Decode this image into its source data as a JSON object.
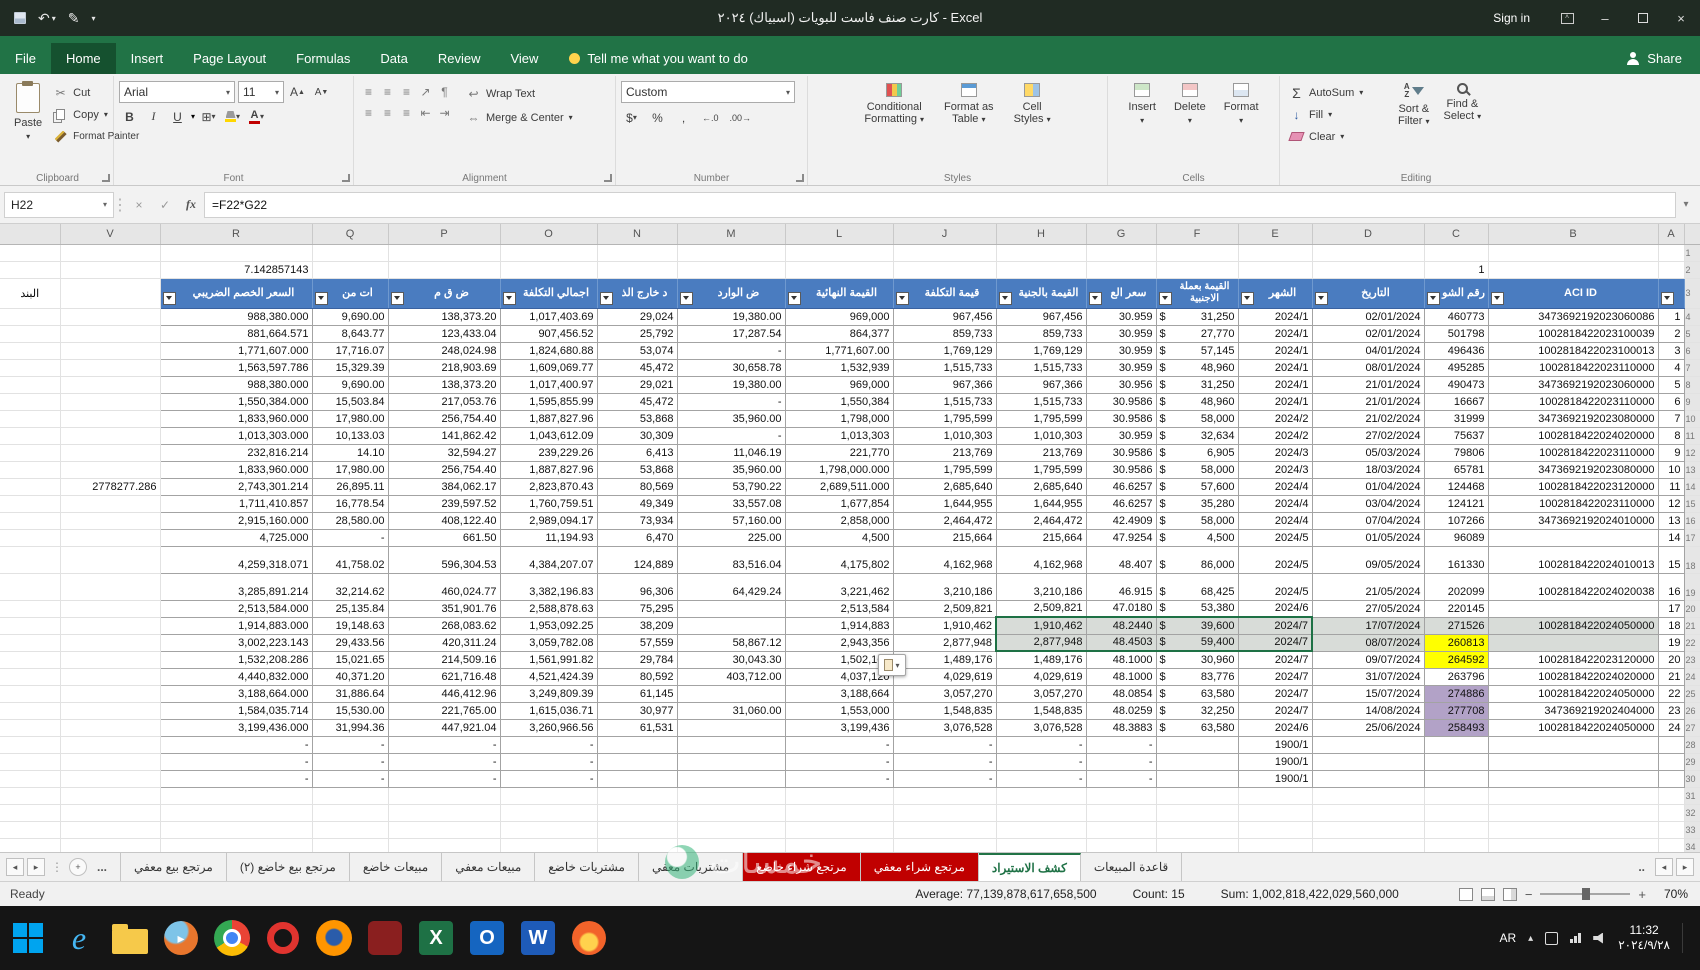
{
  "titlebar": {
    "title": "كارت صنف فاست للبويات (اسبياك) ٢٠٢٤  -  Excel",
    "sign_in": "Sign in"
  },
  "ribbon": {
    "tabs": [
      {
        "label": "File"
      },
      {
        "label": "Home",
        "active": true
      },
      {
        "label": "Insert"
      },
      {
        "label": "Page Layout"
      },
      {
        "label": "Formulas"
      },
      {
        "label": "Data"
      },
      {
        "label": "Review"
      },
      {
        "label": "View"
      }
    ],
    "tell_me": "Tell me what you want to do",
    "share": "Share",
    "clipboard": {
      "label": "Clipboard",
      "paste": "Paste",
      "cut": "Cut",
      "copy": "Copy",
      "format_painter": "Format Painter"
    },
    "font": {
      "label": "Font",
      "family": "Arial",
      "size": "11"
    },
    "alignment": {
      "label": "Alignment",
      "wrap": "Wrap Text",
      "merge": "Merge & Center"
    },
    "number": {
      "label": "Number",
      "format": "Custom"
    },
    "styles": {
      "label": "Styles",
      "cond1": "Conditional",
      "cond2": "Formatting",
      "fat1": "Format as",
      "fat2": "Table",
      "cs1": "Cell",
      "cs2": "Styles"
    },
    "cells": {
      "label": "Cells",
      "insert": "Insert",
      "delete": "Delete",
      "format": "Format"
    },
    "editing": {
      "label": "Editing",
      "autosum": "AutoSum",
      "fill": "Fill",
      "clear": "Clear",
      "sf1": "Sort &",
      "sf2": "Filter",
      "fs1": "Find &",
      "fs2": "Select"
    }
  },
  "formula_bar": {
    "name_box": "H22",
    "fx": "fx",
    "formula": "=F22*G22"
  },
  "sheet": {
    "col_letters": [
      "",
      "V",
      "R",
      "Q",
      "P",
      "O",
      "N",
      "M",
      "L",
      "J",
      "H",
      "G",
      "F",
      "E",
      "D",
      "C",
      "B",
      "A",
      ""
    ],
    "bnd_header": "البند",
    "headers": {
      "r": "السعر الخصم الضريبي",
      "q": "ات من",
      "p": "ض ق م",
      "o": "اجمالي التكلفة",
      "n": "د خارج الذ",
      "m": "ض الوارد",
      "l": "القيمة النهائية",
      "j": "قيمة التكلفة",
      "h": "القيمة بالجنية",
      "g": "سعر الع",
      "f": "القيمة بعملة الاجنبية",
      "e": "الشهر",
      "d": "التاريخ",
      "c": "رقم الشو",
      "b": "ACI ID",
      "a": ""
    },
    "pre": {
      "r": "7.142857143",
      "c": "1"
    },
    "rows": [
      {
        "s": "1",
        "r": "988,380.000",
        "q": "9,690.00",
        "p": "138,373.20",
        "o": "1,017,403.69",
        "n": "29,024",
        "m": "19,380.00",
        "l": "969,000",
        "j": "967,456",
        "h": "967,456",
        "g": "30.959",
        "f": "31,250",
        "e": "2024/1",
        "d": "02/01/2024",
        "c": "460773",
        "b": "3473692192023060086"
      },
      {
        "s": "2",
        "r": "881,664.571",
        "q": "8,643.77",
        "p": "123,433.04",
        "o": "907,456.52",
        "n": "25,792",
        "m": "17,287.54",
        "l": "864,377",
        "j": "859,733",
        "h": "859,733",
        "g": "30.959",
        "f": "27,770",
        "e": "2024/1",
        "d": "02/01/2024",
        "c": "501798",
        "b": "1002818422023100039"
      },
      {
        "s": "3",
        "r": "1,771,607.000",
        "q": "17,716.07",
        "p": "248,024.98",
        "o": "1,824,680.88",
        "n": "53,074",
        "m": "-",
        "l": "1,771,607.00",
        "j": "1,769,129",
        "h": "1,769,129",
        "g": "30.959",
        "f": "57,145",
        "e": "2024/1",
        "d": "04/01/2024",
        "c": "496436",
        "b": "1002818422023100013"
      },
      {
        "s": "4",
        "r": "1,563,597.786",
        "q": "15,329.39",
        "p": "218,903.69",
        "o": "1,609,069.77",
        "n": "45,472",
        "m": "30,658.78",
        "l": "1,532,939",
        "j": "1,515,733",
        "h": "1,515,733",
        "g": "30.959",
        "f": "48,960",
        "e": "2024/1",
        "d": "08/01/2024",
        "c": "495285",
        "b": "1002818422023110000"
      },
      {
        "s": "5",
        "r": "988,380.000",
        "q": "9,690.00",
        "p": "138,373.20",
        "o": "1,017,400.97",
        "n": "29,021",
        "m": "19,380.00",
        "l": "969,000",
        "j": "967,366",
        "h": "967,366",
        "g": "30.956",
        "f": "31,250",
        "e": "2024/1",
        "d": "21/01/2024",
        "c": "490473",
        "b": "3473692192023060000"
      },
      {
        "s": "6",
        "r": "1,550,384.000",
        "q": "15,503.84",
        "p": "217,053.76",
        "o": "1,595,855.99",
        "n": "45,472",
        "m": "-",
        "l": "1,550,384",
        "j": "1,515,733",
        "h": "1,515,733",
        "g": "30.9586",
        "f": "48,960",
        "e": "2024/1",
        "d": "21/01/2024",
        "c": "16667",
        "b": "1002818422023110000"
      },
      {
        "s": "7",
        "r": "1,833,960.000",
        "q": "17,980.00",
        "p": "256,754.40",
        "o": "1,887,827.96",
        "n": "53,868",
        "m": "35,960.00",
        "l": "1,798,000",
        "j": "1,795,599",
        "h": "1,795,599",
        "g": "30.9586",
        "f": "58,000",
        "e": "2024/2",
        "d": "21/02/2024",
        "c": "31999",
        "b": "3473692192023080000"
      },
      {
        "s": "8",
        "r": "1,013,303.000",
        "q": "10,133.03",
        "p": "141,862.42",
        "o": "1,043,612.09",
        "n": "30,309",
        "m": "-",
        "l": "1,013,303",
        "j": "1,010,303",
        "h": "1,010,303",
        "g": "30.959",
        "f": "32,634",
        "e": "2024/2",
        "d": "27/02/2024",
        "c": "75637",
        "b": "1002818422024020000"
      },
      {
        "s": "9",
        "r": "232,816.214",
        "q": "14.10",
        "p": "32,594.27",
        "o": "239,229.26",
        "n": "6,413",
        "m": "11,046.19",
        "l": "221,770",
        "j": "213,769",
        "h": "213,769",
        "g": "30.9586",
        "f": "6,905",
        "e": "2024/3",
        "d": "05/03/2024",
        "c": "79806",
        "b": "1002818422023110000"
      },
      {
        "s": "10",
        "r": "1,833,960.000",
        "q": "17,980.00",
        "p": "256,754.40",
        "o": "1,887,827.96",
        "n": "53,868",
        "m": "35,960.00",
        "l": "1,798,000.000",
        "j": "1,795,599",
        "h": "1,795,599",
        "g": "30.9586",
        "f": "58,000",
        "e": "2024/3",
        "d": "18/03/2024",
        "c": "65781",
        "b": "3473692192023080000"
      },
      {
        "s": "11",
        "v": "2778277.286",
        "r": "2,743,301.214",
        "q": "26,895.11",
        "p": "384,062.17",
        "o": "2,823,870.43",
        "n": "80,569",
        "m": "53,790.22",
        "l": "2,689,511.000",
        "j": "2,685,640",
        "h": "2,685,640",
        "g": "46.6257",
        "f": "57,600",
        "e": "2024/4",
        "d": "01/04/2024",
        "c": "124468",
        "b": "1002818422023120000"
      },
      {
        "s": "12",
        "r": "1,711,410.857",
        "q": "16,778.54",
        "p": "239,597.52",
        "o": "1,760,759.51",
        "n": "49,349",
        "m": "33,557.08",
        "l": "1,677,854",
        "j": "1,644,955",
        "h": "1,644,955",
        "g": "46.6257",
        "f": "35,280",
        "e": "2024/4",
        "d": "03/04/2024",
        "c": "124121",
        "b": "1002818422023110000"
      },
      {
        "s": "13",
        "r": "2,915,160.000",
        "q": "28,580.00",
        "p": "408,122.40",
        "o": "2,989,094.17",
        "n": "73,934",
        "m": "57,160.00",
        "l": "2,858,000",
        "j": "2,464,472",
        "h": "2,464,472",
        "g": "42.4909",
        "f": "58,000",
        "e": "2024/4",
        "d": "07/04/2024",
        "c": "107266",
        "b": "3473692192024010000"
      },
      {
        "s": "14",
        "r": "4,725.000",
        "q": "-",
        "p": "661.50",
        "o": "11,194.93",
        "n": "6,470",
        "m": "225.00",
        "l": "4,500",
        "j": "215,664",
        "h": "215,664",
        "g": "47.9254",
        "f": "4,500",
        "e": "2024/5",
        "d": "01/05/2024",
        "c": "96089",
        "b": ""
      },
      {
        "s": "15",
        "t": 1,
        "r": "4,259,318.071",
        "q": "41,758.02",
        "p": "596,304.53",
        "o": "4,384,207.07",
        "n": "124,889",
        "m": "83,516.04",
        "l": "4,175,802",
        "j": "4,162,968",
        "h": "4,162,968",
        "g": "48.407",
        "f": "86,000",
        "e": "2024/5",
        "d": "09/05/2024",
        "c": "161330",
        "b": "1002818422024010013"
      },
      {
        "s": "16",
        "t": 1,
        "r": "3,285,891.214",
        "q": "32,214.62",
        "p": "460,024.77",
        "o": "3,382,196.83",
        "n": "96,306",
        "m": "64,429.24",
        "l": "3,221,462",
        "j": "3,210,186",
        "h": "3,210,186",
        "g": "46.915",
        "f": "68,425",
        "e": "2024/5",
        "d": "21/05/2024",
        "c": "202099",
        "b": "1002818422024020038"
      },
      {
        "s": "17",
        "r": "2,513,584.000",
        "q": "25,135.84",
        "p": "351,901.76",
        "o": "2,588,878.63",
        "n": "75,295",
        "m": "",
        "l": "2,513,584",
        "j": "2,509,821",
        "h": "2,509,821",
        "g": "47.0180",
        "f": "53,380",
        "e": "2024/6",
        "d": "27/05/2024",
        "c": "220145",
        "b": ""
      },
      {
        "s": "18",
        "sel": "t",
        "fl": {
          "h": "g",
          "g": "g",
          "f": "g",
          "e": "g",
          "d": "g",
          "c": "g",
          "b": "g"
        },
        "r": "1,914,883.000",
        "q": "19,148.63",
        "p": "268,083.62",
        "o": "1,953,092.25",
        "n": "38,209",
        "m": "",
        "l": "1,914,883",
        "j": "1,910,462",
        "h": "1,910,462",
        "g": "48.2440",
        "f": "39,600",
        "e": "2024/7",
        "d": "17/07/2024",
        "c": "271526",
        "b": "1002818422024050000"
      },
      {
        "s": "19",
        "sel": "b",
        "fl": {
          "h": "g",
          "g": "g",
          "f": "g",
          "e": "g",
          "d": "g",
          "c": "y",
          "b": "g"
        },
        "r": "3,002,223.143",
        "q": "29,433.56",
        "p": "420,311.24",
        "o": "3,059,782.08",
        "n": "57,559",
        "m": "58,867.12",
        "l": "2,943,356",
        "j": "2,877,948",
        "h": "2,877,948",
        "g": "48.4503",
        "f": "59,400",
        "e": "2024/7",
        "d": "08/07/2024",
        "c": "260813",
        "b": ""
      },
      {
        "s": "20",
        "fl": {
          "c": "y"
        },
        "r": "1,532,208.286",
        "q": "15,021.65",
        "p": "214,509.16",
        "o": "1,561,991.82",
        "n": "29,784",
        "m": "30,043.30",
        "l": "1,502,165",
        "j": "1,489,176",
        "h": "1,489,176",
        "g": "48.1000",
        "f": "30,960",
        "e": "2024/7",
        "d": "09/07/2024",
        "c": "264592",
        "b": "1002818422023120000"
      },
      {
        "s": "21",
        "r": "4,440,832.000",
        "q": "40,371.20",
        "p": "621,716.48",
        "o": "4,521,424.39",
        "n": "80,592",
        "m": "403,712.00",
        "l": "4,037,120",
        "j": "4,029,619",
        "h": "4,029,619",
        "g": "48.1000",
        "f": "83,776",
        "e": "2024/7",
        "d": "31/07/2024",
        "c": "263796",
        "b": "1002818422024020000"
      },
      {
        "s": "22",
        "fl": {
          "c": "p"
        },
        "r": "3,188,664.000",
        "q": "31,886.64",
        "p": "446,412.96",
        "o": "3,249,809.39",
        "n": "61,145",
        "m": "",
        "l": "3,188,664",
        "j": "3,057,270",
        "h": "3,057,270",
        "g": "48.0854",
        "f": "63,580",
        "e": "2024/7",
        "d": "15/07/2024",
        "c": "274886",
        "b": "1002818422024050000"
      },
      {
        "s": "23",
        "fl": {
          "c": "p"
        },
        "r": "1,584,035.714",
        "q": "15,530.00",
        "p": "221,765.00",
        "o": "1,615,036.71",
        "n": "30,977",
        "m": "31,060.00",
        "l": "1,553,000",
        "j": "1,548,835",
        "h": "1,548,835",
        "g": "48.0259",
        "f": "32,250",
        "e": "2024/7",
        "d": "14/08/2024",
        "c": "277708",
        "b": "347369219202404000"
      },
      {
        "s": "24",
        "fl": {
          "c": "p"
        },
        "r": "3,199,436.000",
        "q": "31,994.36",
        "p": "447,921.04",
        "o": "3,260,966.56",
        "n": "61,531",
        "m": "",
        "l": "3,199,436",
        "j": "3,076,528",
        "h": "3,076,528",
        "g": "48.3883",
        "f": "63,580",
        "e": "2024/6",
        "d": "25/06/2024",
        "c": "258493",
        "b": "1002818422024050000"
      },
      {
        "s": "",
        "r": "-",
        "q": "-",
        "p": "-",
        "o": "-",
        "n": "",
        "m": "",
        "l": "-",
        "j": "-",
        "h": "-",
        "g": "-",
        "f": "",
        "e": "1900/1",
        "d": "",
        "c": "",
        "b": ""
      },
      {
        "s": "",
        "r": "-",
        "q": "-",
        "p": "-",
        "o": "-",
        "n": "",
        "m": "",
        "l": "-",
        "j": "-",
        "h": "-",
        "g": "-",
        "f": "",
        "e": "1900/1",
        "d": "",
        "c": "",
        "b": ""
      },
      {
        "s": "",
        "r": "-",
        "q": "-",
        "p": "-",
        "o": "-",
        "n": "",
        "m": "",
        "l": "-",
        "j": "-",
        "h": "-",
        "g": "-",
        "f": "",
        "e": "1900/1",
        "d": "",
        "c": "",
        "b": ""
      }
    ]
  },
  "tabs_bar": {
    "more_left": "...",
    "more_right": "..",
    "tabs": [
      {
        "label": "مرتجع بيع معفي",
        "type": "normal"
      },
      {
        "label": "مرتجع بيع خاضع (٢)",
        "type": "normal"
      },
      {
        "label": "مبيعات خاضع",
        "type": "normal"
      },
      {
        "label": "مبيعات معفي",
        "type": "normal"
      },
      {
        "label": "مشتريات خاضع",
        "type": "normal"
      },
      {
        "label": "مشتريات معفي",
        "type": "normal"
      },
      {
        "label": "مرتجع شراء خاضع",
        "type": "red"
      },
      {
        "label": "مرتجع شراء معفي",
        "type": "red"
      },
      {
        "label": "كشف الاستيراد",
        "type": "active"
      },
      {
        "label": "قاعدة المبيعات",
        "type": "normal"
      }
    ]
  },
  "status_bar": {
    "ready": "Ready",
    "average": "Average: 77,139,878,617,658,500",
    "count": "Count: 15",
    "sum": "Sum: 1,002,818,422,029,560,000",
    "zoom": "70%"
  },
  "taskbar": {
    "lang": "AR",
    "time": "11:32",
    "date": "٢٠٢٤/٩/٢٨",
    "icons": [
      {
        "name": "start"
      },
      {
        "name": "ie"
      },
      {
        "name": "explorer"
      },
      {
        "name": "media-player"
      },
      {
        "name": "chrome"
      },
      {
        "name": "opera"
      },
      {
        "name": "firefox"
      },
      {
        "name": "app-red"
      },
      {
        "name": "excel"
      },
      {
        "name": "outlook"
      },
      {
        "name": "word"
      },
      {
        "name": "app-flame"
      }
    ]
  },
  "watermark": {
    "text": "خمسات"
  }
}
